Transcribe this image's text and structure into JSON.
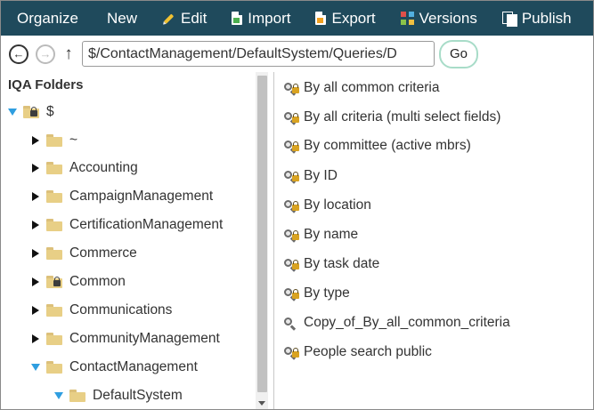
{
  "toolbar": {
    "items": [
      {
        "label": "Organize",
        "icon": "none"
      },
      {
        "label": "New",
        "icon": "none"
      },
      {
        "label": "Edit",
        "icon": "pencil-icon"
      },
      {
        "label": "Import",
        "icon": "import-icon"
      },
      {
        "label": "Export",
        "icon": "export-icon"
      },
      {
        "label": "Versions",
        "icon": "versions-icon"
      },
      {
        "label": "Publish",
        "icon": "publish-icon"
      }
    ]
  },
  "nav": {
    "back_icon": "back-arrow-icon",
    "forward_icon": "forward-arrow-icon",
    "up_icon": "up-arrow-icon",
    "path_value": "$/ContactManagement/DefaultSystem/Queries/D",
    "go_label": "Go"
  },
  "folders_panel": {
    "title": "IQA Folders",
    "tree": [
      {
        "label": "$",
        "expanded": true,
        "locked": true,
        "level": 0
      },
      {
        "label": "~",
        "expanded": false,
        "locked": false,
        "level": 1
      },
      {
        "label": "Accounting",
        "expanded": false,
        "locked": false,
        "level": 1
      },
      {
        "label": "CampaignManagement",
        "expanded": false,
        "locked": false,
        "level": 1
      },
      {
        "label": "CertificationManagement",
        "expanded": false,
        "locked": false,
        "level": 1
      },
      {
        "label": "Commerce",
        "expanded": false,
        "locked": false,
        "level": 1
      },
      {
        "label": "Common",
        "expanded": false,
        "locked": true,
        "level": 1
      },
      {
        "label": "Communications",
        "expanded": false,
        "locked": false,
        "level": 1
      },
      {
        "label": "CommunityManagement",
        "expanded": false,
        "locked": false,
        "level": 1
      },
      {
        "label": "ContactManagement",
        "expanded": true,
        "locked": false,
        "level": 1
      },
      {
        "label": "DefaultSystem",
        "expanded": true,
        "locked": false,
        "level": 2
      }
    ]
  },
  "queries": [
    {
      "label": "By all common criteria",
      "locked": true
    },
    {
      "label": "By all criteria (multi select fields)",
      "locked": true
    },
    {
      "label": "By committee (active mbrs)",
      "locked": true
    },
    {
      "label": "By ID",
      "locked": true
    },
    {
      "label": "By location",
      "locked": true
    },
    {
      "label": "By name",
      "locked": true
    },
    {
      "label": "By task date",
      "locked": true
    },
    {
      "label": "By type",
      "locked": true
    },
    {
      "label": "Copy_of_By_all_common_criteria",
      "locked": false
    },
    {
      "label": "People search public",
      "locked": true
    }
  ],
  "colors": {
    "toolbar_bg": "#1f4a5c",
    "tree_expand_arrow": "#2f9ee0",
    "folder": "#e8cf86"
  }
}
